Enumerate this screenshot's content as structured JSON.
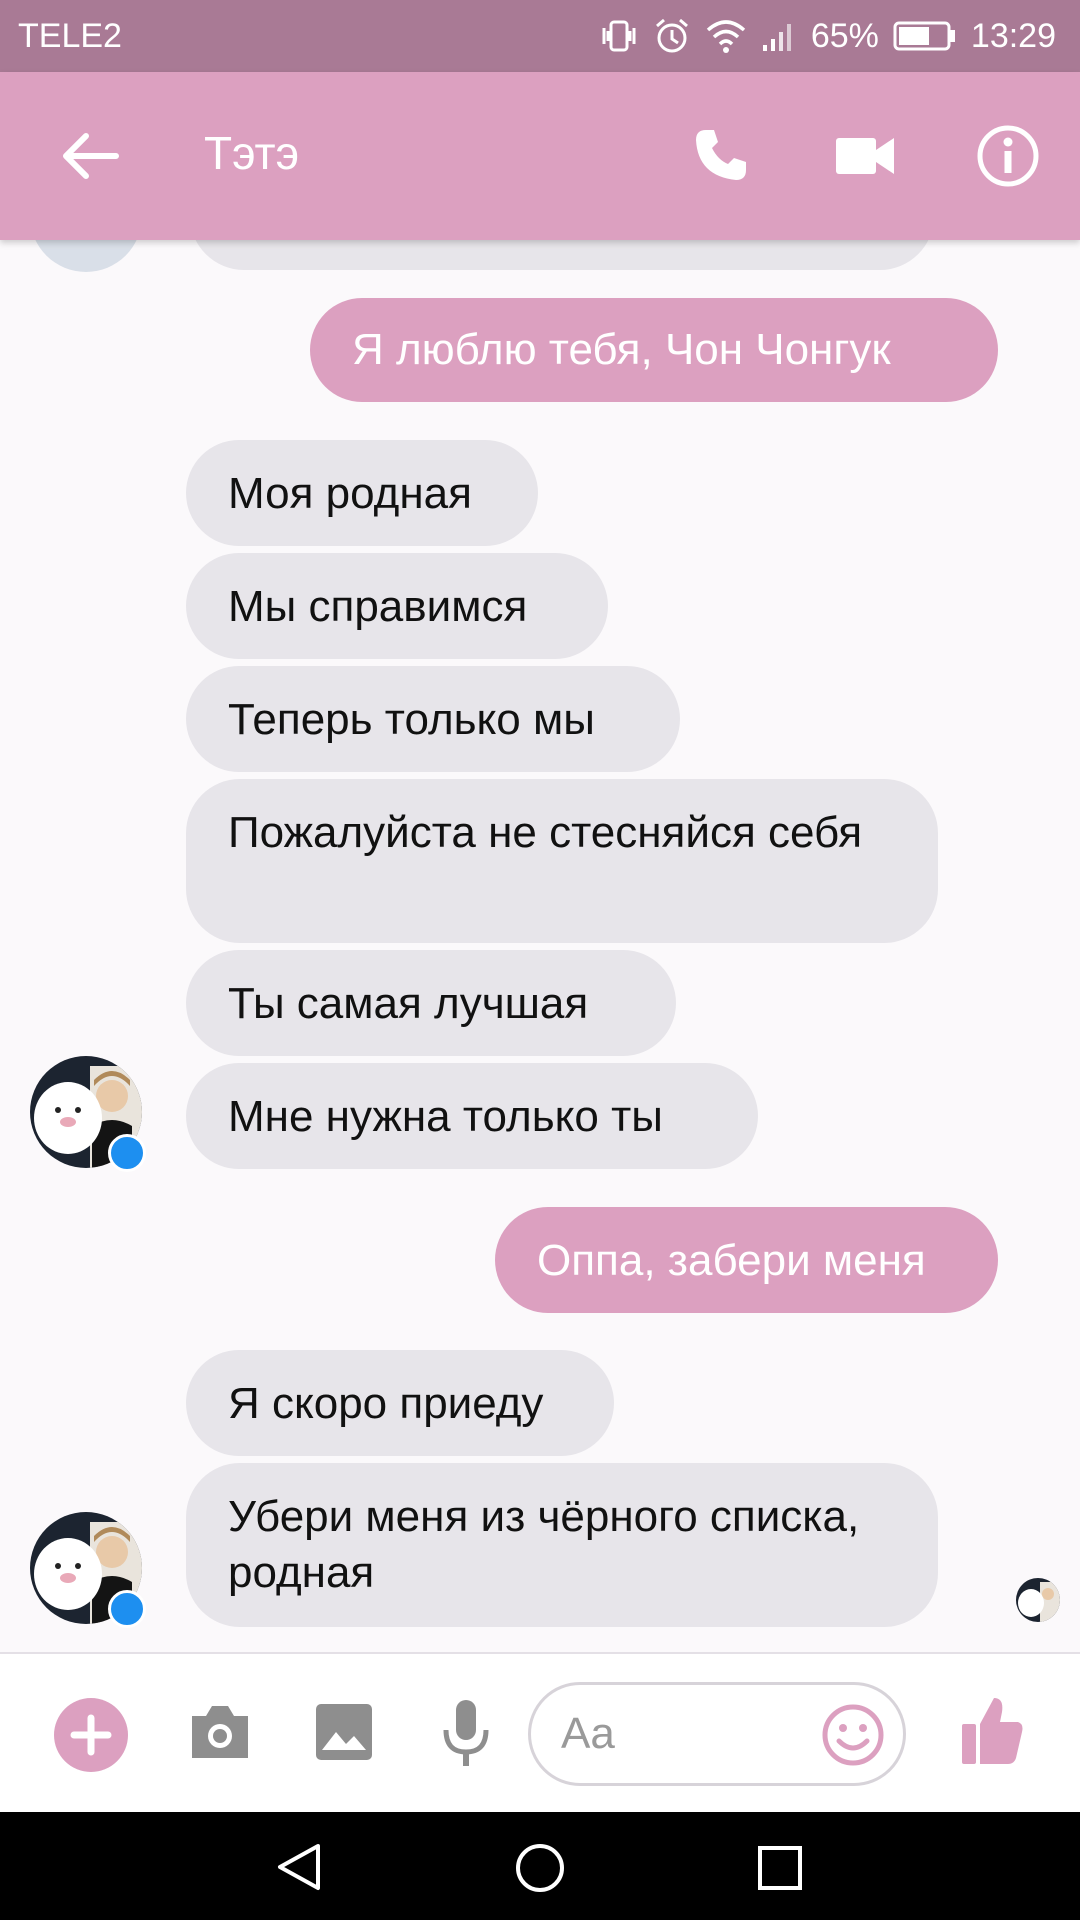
{
  "status_bar": {
    "carrier": "TELE2",
    "battery_percent": "65%",
    "time": "13:29"
  },
  "header": {
    "contact_name": "Тэтэ",
    "icons": [
      "back-arrow-icon",
      "phone-icon",
      "video-camera-icon",
      "info-icon"
    ]
  },
  "messages": [
    {
      "direction": "out",
      "text": "Я люблю тебя, Чон Чонгук"
    },
    {
      "direction": "in",
      "text": "Моя родная"
    },
    {
      "direction": "in",
      "text": "Мы справимся"
    },
    {
      "direction": "in",
      "text": "Теперь только мы"
    },
    {
      "direction": "in",
      "text": "Пожалуйста не стесняйся себя"
    },
    {
      "direction": "in",
      "text": "Ты самая лучшая"
    },
    {
      "direction": "in",
      "text": "Мне нужна только ты"
    },
    {
      "direction": "out",
      "text": "Оппа, забери меня"
    },
    {
      "direction": "in",
      "text": "Я скоро приеду"
    },
    {
      "direction": "in",
      "text": "Убери меня из чёрного списка, родная"
    }
  ],
  "composer": {
    "placeholder": "Aa",
    "icons": [
      "plus-icon",
      "camera-icon",
      "gallery-icon",
      "microphone-icon",
      "emoji-icon",
      "thumbs-up-icon"
    ]
  },
  "colors": {
    "accent": "#dca0c0",
    "status_bar": "#a97a95",
    "incoming_bubble": "#e7e5ea",
    "messenger_badge": "#1d8ff0"
  }
}
